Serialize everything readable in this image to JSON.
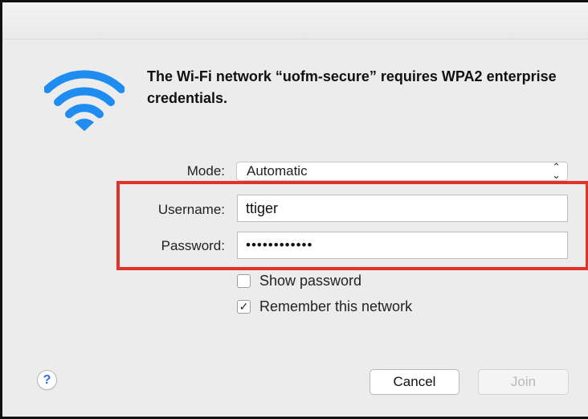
{
  "dialog": {
    "message": "The Wi-Fi network “uofm-secure” requires WPA2 enterprise credentials."
  },
  "form": {
    "mode_label": "Mode:",
    "mode_value": "Automatic",
    "username_label": "Username:",
    "username_value": "ttiger",
    "password_label": "Password:",
    "password_value": "••••••••••••",
    "show_password_label": "Show password",
    "show_password_checked": false,
    "remember_network_label": "Remember this network",
    "remember_network_checked": true,
    "remember_check_glyph": "✓"
  },
  "buttons": {
    "help_label": "?",
    "cancel_label": "Cancel",
    "join_label": "Join"
  },
  "icons": {
    "wifi": "wifi-icon",
    "select_arrows": "up-down-chevron-icon",
    "help": "question-mark-icon"
  },
  "colors": {
    "wifi_blue": "#1e8cf0",
    "highlight_red": "#e0342a",
    "help_blue": "#2d6ee8"
  }
}
